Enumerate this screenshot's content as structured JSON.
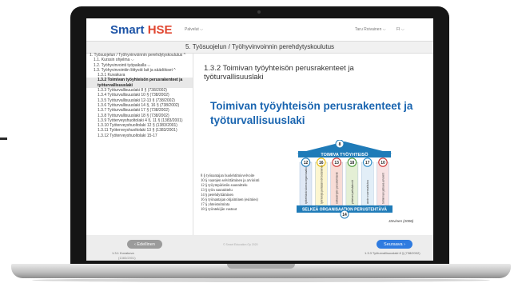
{
  "app": {
    "brand_prefix": "Smart ",
    "brand_suffix": "HSE",
    "services_menu": "Palvelut ⌵",
    "user_menu": "Taru Roivainen ⌵",
    "language_menu": "FI ⌵"
  },
  "course": {
    "title": "5. Työsuojelun / Työhyvinvoinnin perehdytyskoulutus"
  },
  "sidebar": {
    "items": [
      {
        "label": "1. Työsuojelun / Työhyvinvoinnin perehdytyskoulutus ^",
        "indent": 0
      },
      {
        "label": "1.1. Kurssin ohjelma ⌵",
        "indent": 1
      },
      {
        "label": "1.2. Työhyvinvointi työpaikalla ⌵",
        "indent": 1
      },
      {
        "label": "1.3. Työhyvinvointiin liittyvät lait ja säädökset ^",
        "indent": 1
      },
      {
        "label": "1.3.1 Kuvakuva",
        "indent": 2
      },
      {
        "label": "1.3.2 Toimivan työyhteisön perusrakenteet ja työturvallisuuslaki",
        "indent": 2,
        "active": true
      },
      {
        "label": "1.3.3 Työturvallisuuslaki 8 § (738/2002)",
        "indent": 2
      },
      {
        "label": "1.3.4 Työturvallisuuslaki 10 § (738/2002)",
        "indent": 2
      },
      {
        "label": "1.3.5 Työturvallisuuslaki 12-13 § (738/2002)",
        "indent": 2
      },
      {
        "label": "1.3.6 Työturvallisuuslaki 14 §, 16 § (738/2002)",
        "indent": 2
      },
      {
        "label": "1.3.7 Työturvallisuuslaki 17 § (738/2002)",
        "indent": 2
      },
      {
        "label": "1.3.8 Työturvallisuuslaki 18 § (738/2002)",
        "indent": 2
      },
      {
        "label": "1.3.9 Työterveyshuoltolaki 4 §, 11 § (1383/2001)",
        "indent": 2
      },
      {
        "label": "1.3.10 Työterveyshuoltolaki 12 § (1383/2001)",
        "indent": 2
      },
      {
        "label": "1.3.11 Työterveyshuoltolaki 13 § (1383/2001)",
        "indent": 2
      },
      {
        "label": "1.3.12 Työterveyshuoltolaki 15-17",
        "indent": 2
      }
    ]
  },
  "lesson": {
    "title": "1.3.2 Toimivan työyhteisön perusrakenteet ja työturvallisuuslaki"
  },
  "slide": {
    "title": "Toimivan työyhteisön perusrakenteet ja työturvallisuuslaki",
    "laws": [
      "8 §  työnantajan huolehtimisvelvoite",
      "10 §  vaarojen selvittäminen ja arviointi",
      "12 §  työympäristön suunnittelu",
      "13 §  työn suunnittelu",
      "14 §  perehdyttäminen",
      "16 §  työnantajan ohjaiminen (esimies)",
      "17 §  yhteistoiminta",
      "18 §  työntekijän vastuut"
    ],
    "diagram": {
      "top_number": "8",
      "roof_label": "TOIMIVA TYÖYHTEISÖ",
      "column_numbers": [
        "12",
        "16",
        "13",
        "18",
        "17",
        "10"
      ],
      "column_labels": [
        "työtehtävä tukeva organisaatio",
        "työntekijä pelisäännöt tietäminen",
        "selkeät työn perustehtävät",
        "yhteiset pelisäännöt",
        "avoin vuorovaikutus",
        "toiminnan jatkuva arviointi"
      ],
      "base_label": "SELKEÄ ORGANISAATION PERUSTEHTÄVÄ",
      "base_number": "14",
      "source": "Järvinen (2006)"
    }
  },
  "footer": {
    "prev_label": "‹ Edellinen",
    "prev_sub": "1.3.1 Kuvakuva",
    "prev_sub2": "(1383/2001)",
    "center_text": "© Smart Education Oy 2020",
    "next_label": "Seuraava ›",
    "next_sub": "1.3.3 Työturvallisuuslaki 8 § (738/2002)"
  },
  "colors": {
    "brand_blue": "#1c53a6",
    "brand_red": "#e0452f",
    "diagram_blue": "#1f7bb8",
    "column_fills": [
      "#dfe8f5",
      "#fcf6d0",
      "#f8dcd6",
      "#e4efd5",
      "#e2eef7",
      "#f8e3e4"
    ],
    "number_borders": [
      "#1f7bb8",
      "#e6b800",
      "#cc3333",
      "#4a9a38",
      "#2c8cc8",
      "#cc3333"
    ]
  }
}
